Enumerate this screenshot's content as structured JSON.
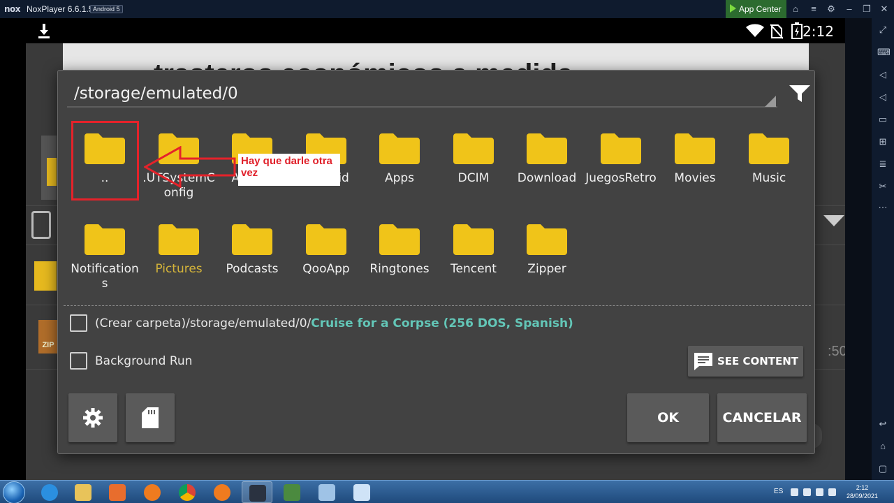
{
  "window": {
    "logo": "nox",
    "title": "NoxPlayer 6.6.1.5",
    "android_version": "Android 5",
    "app_center_label": "App Center"
  },
  "status_bar": {
    "time": "2:12"
  },
  "background": {
    "ad_text": "trasteros económicos a medida",
    "partial_time": ":50",
    "zip_label": "ZIP"
  },
  "dialog": {
    "path": "/storage/emulated/0",
    "folders": [
      {
        "label": ".."
      },
      {
        "label": ".UTSystemConfig"
      },
      {
        "label": "Alarms"
      },
      {
        "label": "Android"
      },
      {
        "label": "Apps"
      },
      {
        "label": "DCIM"
      },
      {
        "label": "Download"
      },
      {
        "label": "JuegosRetro"
      },
      {
        "label": "Movies"
      },
      {
        "label": "Music"
      },
      {
        "label": "Notifications"
      },
      {
        "label": "Pictures"
      },
      {
        "label": "Podcasts"
      },
      {
        "label": "QooApp"
      },
      {
        "label": "Ringtones"
      },
      {
        "label": "Tencent"
      },
      {
        "label": "Zipper"
      }
    ],
    "annotation_note": "Hay que darle otra vez",
    "create_folder": {
      "prefix": "(Crear carpeta)/storage/emulated/0/",
      "name": "Cruise for a Corpse (256 DOS, Spanish)"
    },
    "background_run_label": "Background Run",
    "see_content_label": "SEE CONTENT",
    "ok_label": "OK",
    "cancel_label": "CANCELAR"
  },
  "taskbar": {
    "language": "ES",
    "clock_time": "2:12",
    "clock_date": "28/09/2021"
  },
  "colors": {
    "folder": "#f0c419",
    "highlight_label": "#d4b43a",
    "teal": "#63c6b7",
    "annotation_red": "#e5222a",
    "dialog_bg": "#424242"
  }
}
